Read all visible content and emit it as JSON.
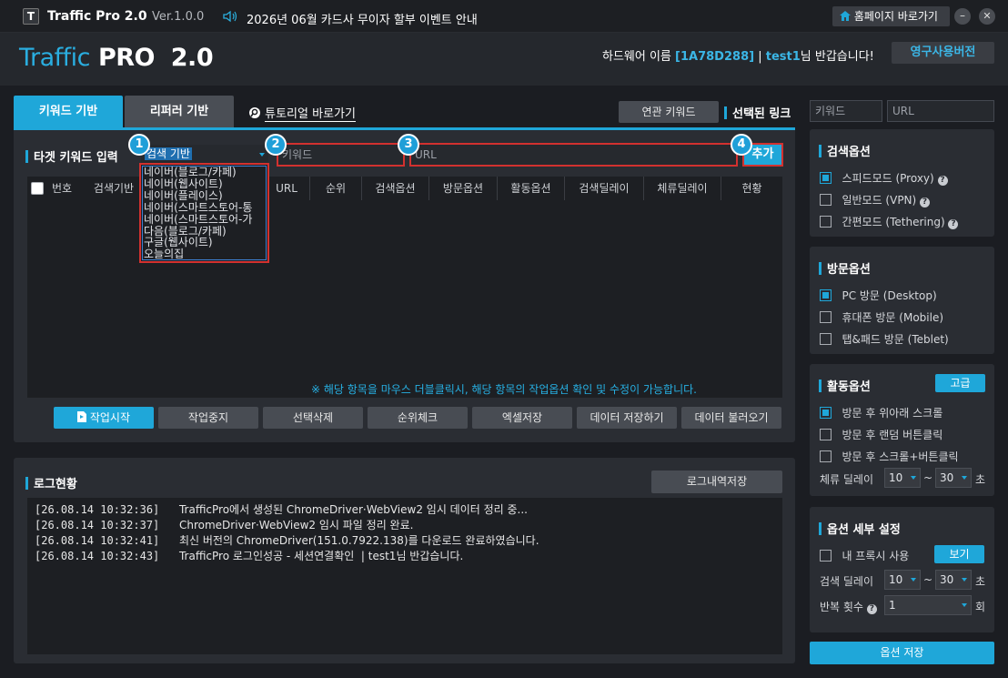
{
  "titlebar": {
    "logo_letter": "T",
    "app_name": "Traffic Pro 2.0",
    "version": "Ver.1.0.0",
    "notice": "2026년 06월 카드사 무이자 할부 이벤트 안내",
    "home_button": "홈페이지 바로가기"
  },
  "header": {
    "brand_left": "Traffic",
    "brand_right": "PRO  2.0",
    "hwid_label": "하드웨어 이름",
    "hwid": "[1A78D288]",
    "separator": "|",
    "user": "test1",
    "greeting": "님 반갑습니다!",
    "license_button": "영구사용버전"
  },
  "tabs": {
    "keyword": "키워드 기반",
    "referrer": "리퍼러 기반",
    "tutorial": "튜토리얼 바로가기",
    "related": "연관 키워드"
  },
  "selected_link": {
    "title": "선택된 링크",
    "keyword_placeholder": "키워드",
    "url_placeholder": "URL"
  },
  "target": {
    "title": "타겟 키워드 입력",
    "search_type": "검색 기반",
    "keyword_placeholder": "키워드",
    "url_placeholder": "URL",
    "add": "추가",
    "badges": [
      "1",
      "2",
      "3",
      "4"
    ]
  },
  "dropdown": [
    "네이버(블로그/카페)",
    "네이버(웹사이트)",
    "네이버(플레이스)",
    "네이버(스마트스토어-통",
    "네이버(스마트스토어-가",
    "다음(블로그/카페)",
    "구글(웹사이트)",
    "오늘의집"
  ],
  "table": {
    "columns": [
      "번호",
      "검색기반",
      "",
      "URL",
      "순위",
      "검색옵션",
      "방문옵션",
      "활동옵션",
      "검색딜레이",
      "체류딜레이",
      "현황"
    ],
    "hint": "※ 해당 항목을 마우스 더블클릭시, 해당 항목의 작업옵션 확인 및 수정이 가능합니다."
  },
  "actions": {
    "start": "작업시작",
    "stop": "작업중지",
    "delete": "선택삭제",
    "rank": "순위체크",
    "excel": "엑셀저장",
    "save": "데이터 저장하기",
    "load": "데이터 불러오기"
  },
  "log": {
    "title": "로그현황",
    "save": "로그내역저장",
    "lines": [
      {
        "time": "[26.08.14 10:32:36]",
        "msg": "TrafficPro에서 생성된 ChromeDriver·WebView2 임시 데이터 정리 중..."
      },
      {
        "time": "[26.08.14 10:32:37]",
        "msg": "ChromeDriver·WebView2 임시 파일 정리 완료."
      },
      {
        "time": "[26.08.14 10:32:41]",
        "msg": "최신 버전의 ChromeDriver(151.0.7922.138)를 다운로드 완료하였습니다."
      },
      {
        "time": "[26.08.14 10:32:43]",
        "msg": "TrafficPro 로그인성공 - 세션연결확인  | test1님 반갑습니다."
      }
    ]
  },
  "search_options": {
    "title": "검색옵션",
    "items": [
      {
        "label": "스피드모드 (Proxy)",
        "checked": true
      },
      {
        "label": "일반모드 (VPN)",
        "checked": false
      },
      {
        "label": "간편모드 (Tethering)",
        "checked": false
      }
    ]
  },
  "visit_options": {
    "title": "방문옵션",
    "items": [
      {
        "label": "PC 방문 (Desktop)",
        "checked": true
      },
      {
        "label": "휴대폰 방문 (Mobile)",
        "checked": false
      },
      {
        "label": "탭&패드 방문 (Teblet)",
        "checked": false
      }
    ]
  },
  "activity_options": {
    "title": "활동옵션",
    "advanced": "고급",
    "items": [
      {
        "label": "방문 후 위아래 스크롤",
        "checked": true
      },
      {
        "label": "방문 후 랜덤 버튼클릭",
        "checked": false
      },
      {
        "label": "방문 후 스크롤+버튼클릭",
        "checked": false
      }
    ],
    "dwell_label": "체류 딜레이",
    "dwell_min": "10",
    "tilde": "~",
    "dwell_max": "30",
    "unit": "초"
  },
  "detail": {
    "title": "옵션 세부 설정",
    "proxy_label": "내 프록시 사용",
    "view": "보기",
    "delay_label": "검색 딜레이",
    "delay_min": "10",
    "tilde": "~",
    "delay_max": "30",
    "unit": "초",
    "repeat_label": "반복 횟수",
    "repeat": "1",
    "repeat_unit": "회"
  },
  "save_options": "옵션 저장",
  "colors": {
    "accent": "#1fa7d9",
    "danger": "#d2312f",
    "bg": "#1b1d22",
    "panel": "#2a2d33"
  }
}
